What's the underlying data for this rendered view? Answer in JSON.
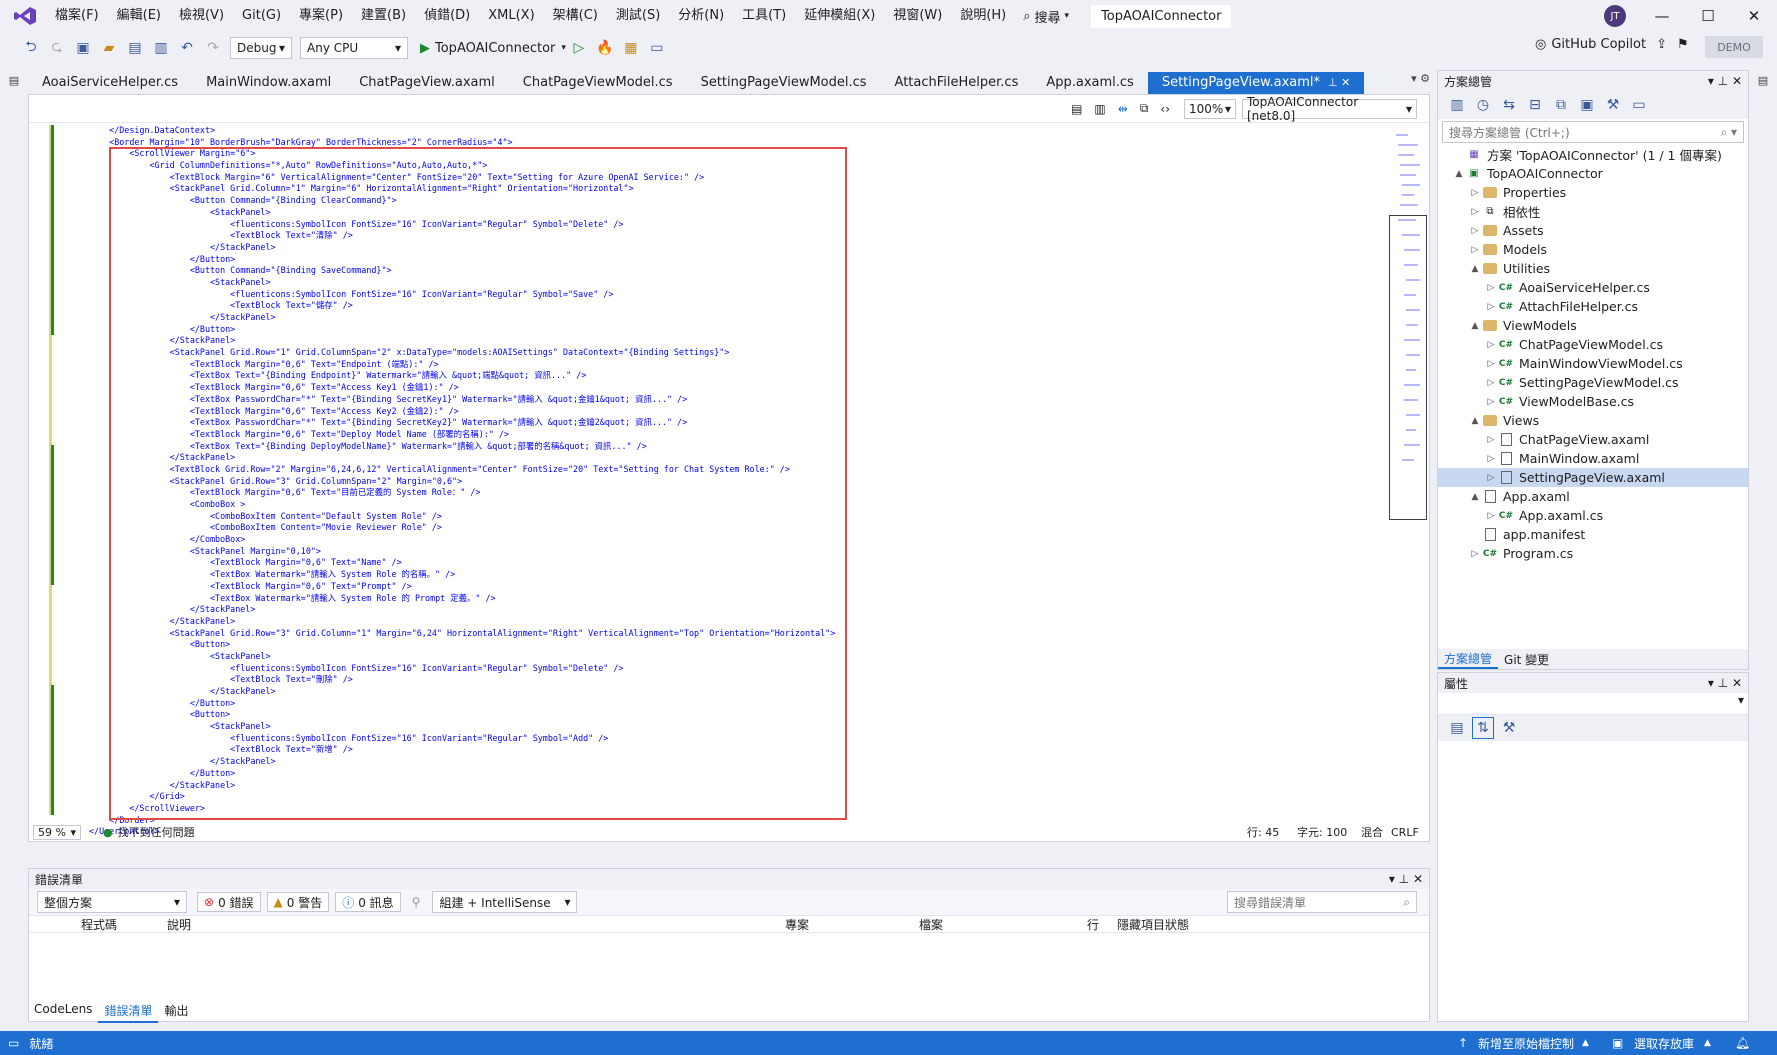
{
  "menu": [
    "檔案(F)",
    "編輯(E)",
    "檢視(V)",
    "Git(G)",
    "專案(P)",
    "建置(B)",
    "偵錯(D)",
    "XML(X)",
    "架構(C)",
    "測試(S)",
    "分析(N)",
    "工具(T)",
    "延伸模組(X)",
    "視窗(W)",
    "說明(H)"
  ],
  "search_label": "搜尋",
  "solution_title": "TopAOAIConnector",
  "avatar": "JT",
  "toolbar": {
    "config": "Debug",
    "platform": "Any CPU",
    "start": "TopAOAIConnector",
    "copilot": "GitHub Copilot",
    "demo": "DEMO"
  },
  "tabs": [
    "AoaiServiceHelper.cs",
    "MainWindow.axaml",
    "ChatPageView.axaml",
    "ChatPageViewModel.cs",
    "SettingPageViewModel.cs",
    "AttachFileHelper.cs",
    "App.axaml.cs",
    "SettingPageView.axaml*"
  ],
  "editor": {
    "zoom": "100%",
    "target": "TopAOAIConnector [net8.0]",
    "bottom_zoom": "59 %",
    "issues": "找不到任何問題",
    "line": "行: 45",
    "col": "字元: 100",
    "mode": "混合",
    "eol": "CRLF"
  },
  "code": [
    "    </Design.DataContext>",
    "    <Border Margin=\"10\" BorderBrush=\"DarkGray\" BorderThickness=\"2\" CornerRadius=\"4\">",
    "        <ScrollViewer Margin=\"6\">",
    "            <Grid ColumnDefinitions=\"*,Auto\" RowDefinitions=\"Auto,Auto,Auto,*\">",
    "                <TextBlock Margin=\"6\" VerticalAlignment=\"Center\" FontSize=\"20\" Text=\"Setting for Azure OpenAI Service:\" />",
    "                <StackPanel Grid.Column=\"1\" Margin=\"6\" HorizontalAlignment=\"Right\" Orientation=\"Horizontal\">",
    "                    <Button Command=\"{Binding ClearCommand}\">",
    "                        <StackPanel>",
    "                            <fluenticons:SymbolIcon FontSize=\"16\" IconVariant=\"Regular\" Symbol=\"Delete\" />",
    "                            <TextBlock Text=\"清除\" />",
    "                        </StackPanel>",
    "                    </Button>",
    "                    <Button Command=\"{Binding SaveCommand}\">",
    "                        <StackPanel>",
    "                            <fluenticons:SymbolIcon FontSize=\"16\" IconVariant=\"Regular\" Symbol=\"Save\" />",
    "                            <TextBlock Text=\"儲存\" />",
    "                        </StackPanel>",
    "                    </Button>",
    "                </StackPanel>",
    "                <StackPanel Grid.Row=\"1\" Grid.ColumnSpan=\"2\" x:DataType=\"models:AOAISettings\" DataContext=\"{Binding Settings}\">",
    "                    <TextBlock Margin=\"0,6\" Text=\"Endpoint (端點):\" />",
    "                    <TextBox Text=\"{Binding Endpoint}\" Watermark=\"請輸入 &quot;端點&quot; 資訊...\" />",
    "                    <TextBlock Margin=\"0,6\" Text=\"Access Key1 (金鑰1):\" />",
    "                    <TextBox PasswordChar=\"*\" Text=\"{Binding SecretKey1}\" Watermark=\"請輸入 &quot;金鑰1&quot; 資訊...\" />",
    "                    <TextBlock Margin=\"0,6\" Text=\"Access Key2 (金鑰2):\" />",
    "                    <TextBox PasswordChar=\"*\" Text=\"{Binding SecretKey2}\" Watermark=\"請輸入 &quot;金鑰2&quot; 資訊...\" />",
    "                    <TextBlock Margin=\"0,6\" Text=\"Deploy Model Name (部署的名稱):\" />",
    "                    <TextBox Text=\"{Binding DeployModelName}\" Watermark=\"請輸入 &quot;部署的名稱&quot; 資訊...\" />",
    "                </StackPanel>",
    "                <TextBlock Grid.Row=\"2\" Margin=\"6,24,6,12\" VerticalAlignment=\"Center\" FontSize=\"20\" Text=\"Setting for Chat System Role:\" />",
    "                <StackPanel Grid.Row=\"3\" Grid.ColumnSpan=\"2\" Margin=\"0,6\">",
    "                    <TextBlock Margin=\"0,6\" Text=\"目前已定義的 System Role：\" />",
    "                    <ComboBox >",
    "                        <ComboBoxItem Content=\"Default System Role\" />",
    "                        <ComboBoxItem Content=\"Movie Reviewer Role\" />",
    "                    </ComboBox>",
    "                    <StackPanel Margin=\"0,10\">",
    "                        <TextBlock Margin=\"0,6\" Text=\"Name\" />",
    "                        <TextBox Watermark=\"請輸入 System Role 的名稱。\" />",
    "                        <TextBlock Margin=\"0,6\" Text=\"Prompt\" />",
    "                        <TextBox Watermark=\"請輸入 System Role 的 Prompt 定義。\" />",
    "                    </StackPanel>",
    "                </StackPanel>",
    "                <StackPanel Grid.Row=\"3\" Grid.Column=\"1\" Margin=\"6,24\" HorizontalAlignment=\"Right\" VerticalAlignment=\"Top\" Orientation=\"Horizontal\">",
    "                    <Button>",
    "                        <StackPanel>",
    "                            <fluenticons:SymbolIcon FontSize=\"16\" IconVariant=\"Regular\" Symbol=\"Delete\" />",
    "                            <TextBlock Text=\"刪除\" />",
    "                        </StackPanel>",
    "                    </Button>",
    "                    <Button>",
    "                        <StackPanel>",
    "                            <fluenticons:SymbolIcon FontSize=\"16\" IconVariant=\"Regular\" Symbol=\"Add\" />",
    "                            <TextBlock Text=\"新增\" />",
    "                        </StackPanel>",
    "                    </Button>",
    "                </StackPanel>",
    "            </Grid>",
    "        </ScrollViewer>",
    "    </Border>",
    "</UserControl>"
  ],
  "error_panel": {
    "title": "錯誤清單",
    "scope": "整個方案",
    "errors": "0 錯誤",
    "warnings": "0 警告",
    "messages": "0 訊息",
    "build": "組建 + IntelliSense",
    "search": "搜尋錯誤清單",
    "cols": [
      "程式碼",
      "說明",
      "專案",
      "檔案",
      "行",
      "隱藏項目狀態"
    ]
  },
  "bottom_tabs": [
    "CodeLens",
    "錯誤清單",
    "輸出"
  ],
  "solution_explorer": {
    "title": "方案總管",
    "search": "搜尋方案總管 (Ctrl+;)",
    "foot": [
      "方案總管",
      "Git 變更"
    ],
    "tree": [
      {
        "label": "方案 'TopAOAIConnector' (1 / 1 個專案)",
        "level": 0,
        "kind": "solution",
        "arrow": ""
      },
      {
        "label": "TopAOAIConnector",
        "level": 0,
        "kind": "project",
        "arrow": "▲"
      },
      {
        "label": "Properties",
        "level": 1,
        "kind": "folder",
        "arrow": "▷"
      },
      {
        "label": "相依性",
        "level": 1,
        "kind": "deps",
        "arrow": "▷"
      },
      {
        "label": "Assets",
        "level": 1,
        "kind": "folder",
        "arrow": "▷"
      },
      {
        "label": "Models",
        "level": 1,
        "kind": "folder",
        "arrow": "▷"
      },
      {
        "label": "Utilities",
        "level": 1,
        "kind": "folder",
        "arrow": "▲"
      },
      {
        "label": "AoaiServiceHelper.cs",
        "level": 2,
        "kind": "cs",
        "arrow": "▷"
      },
      {
        "label": "AttachFileHelper.cs",
        "level": 2,
        "kind": "cs",
        "arrow": "▷"
      },
      {
        "label": "ViewModels",
        "level": 1,
        "kind": "folder",
        "arrow": "▲"
      },
      {
        "label": "ChatPageViewModel.cs",
        "level": 2,
        "kind": "cs",
        "arrow": "▷"
      },
      {
        "label": "MainWindowViewModel.cs",
        "level": 2,
        "kind": "cs",
        "arrow": "▷"
      },
      {
        "label": "SettingPageViewModel.cs",
        "level": 2,
        "kind": "cs",
        "arrow": "▷"
      },
      {
        "label": "ViewModelBase.cs",
        "level": 2,
        "kind": "cs",
        "arrow": "▷"
      },
      {
        "label": "Views",
        "level": 1,
        "kind": "folder",
        "arrow": "▲"
      },
      {
        "label": "ChatPageView.axaml",
        "level": 2,
        "kind": "file",
        "arrow": "▷"
      },
      {
        "label": "MainWindow.axaml",
        "level": 2,
        "kind": "file",
        "arrow": "▷"
      },
      {
        "label": "SettingPageView.axaml",
        "level": 2,
        "kind": "file",
        "arrow": "▷",
        "selected": true
      },
      {
        "label": "App.axaml",
        "level": 1,
        "kind": "file",
        "arrow": "▲"
      },
      {
        "label": "App.axaml.cs",
        "level": 2,
        "kind": "cs",
        "arrow": "▷"
      },
      {
        "label": "app.manifest",
        "level": 1,
        "kind": "file",
        "arrow": ""
      },
      {
        "label": "Program.cs",
        "level": 1,
        "kind": "cs",
        "arrow": "▷"
      }
    ]
  },
  "properties": {
    "title": "屬性"
  },
  "status": {
    "ready": "就緒",
    "source": "新增至原始檔控制",
    "repo": "選取存放庫"
  }
}
